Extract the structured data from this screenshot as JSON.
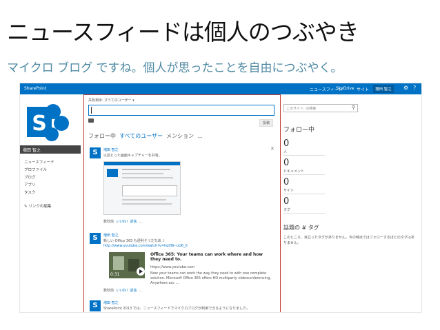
{
  "slide": {
    "title": "ニュースフィードは個人のつぶやき",
    "subtitle": "マイクロ ブログ ですね。個人が思ったことを自由につぶやく。"
  },
  "topbar": {
    "brand": "SharePoint",
    "links": [
      "ニュースフィード",
      "SkyDrive",
      "サイト"
    ],
    "user": "増田 智之",
    "icons": [
      "gear-icon",
      "help-icon"
    ]
  },
  "sidebar": {
    "user_name": "増田 智之",
    "items": [
      "ニュースフィード",
      "プロファイル",
      "ブログ",
      "アプリ",
      "タスク"
    ],
    "edit_link": "リンクの編集"
  },
  "composer": {
    "share_label": "共有相手: すべてのユーザー ▾",
    "post_button": "投稿"
  },
  "tabs": {
    "following": "フォロー中",
    "everyone": "すべてのユーザー",
    "mentions": "メンション",
    "more": "..."
  },
  "posts": [
    {
      "author": "増田 智之",
      "text": "以前とった画面キャプチャーを共有。",
      "actions": [
        "数秒前",
        "いいね!",
        "返信",
        "..."
      ]
    },
    {
      "author": "増田 智之",
      "text": "新しい Office 365 も便利そうだなあ ♪",
      "link": "http://www.youtube.com/watch?v=hq0W--uU6_0",
      "video": {
        "title": "Office 365: Your teams can work where and how they need to.",
        "url": "https://www.youtube.com",
        "desc": "Now your teams can work the way they need to with one complete solution. Microsoft Office 365 offers HD multiparty videoconferencing, Anywhere acc ...",
        "time": "0:31"
      },
      "actions": [
        "数秒前",
        "いいね!",
        "返信",
        "..."
      ]
    },
    {
      "author": "増田 智之",
      "text": "SharePoint 2013 では、ニュースフィードでマイクロブログが利用できるようになりました。"
    }
  ],
  "right": {
    "search_placeholder": "このサイト: の検索",
    "follow_heading": "フォロー中",
    "stats": [
      {
        "value": "0",
        "label": "人"
      },
      {
        "value": "0",
        "label": "ドキュメント"
      },
      {
        "value": "0",
        "label": "サイト"
      },
      {
        "value": "0",
        "label": "タグ"
      }
    ],
    "tags_heading": "話題の # タグ",
    "tags_text": "このところ、目立ったタグがありません。今の時点ではフォローするほどのタグはありません。"
  }
}
